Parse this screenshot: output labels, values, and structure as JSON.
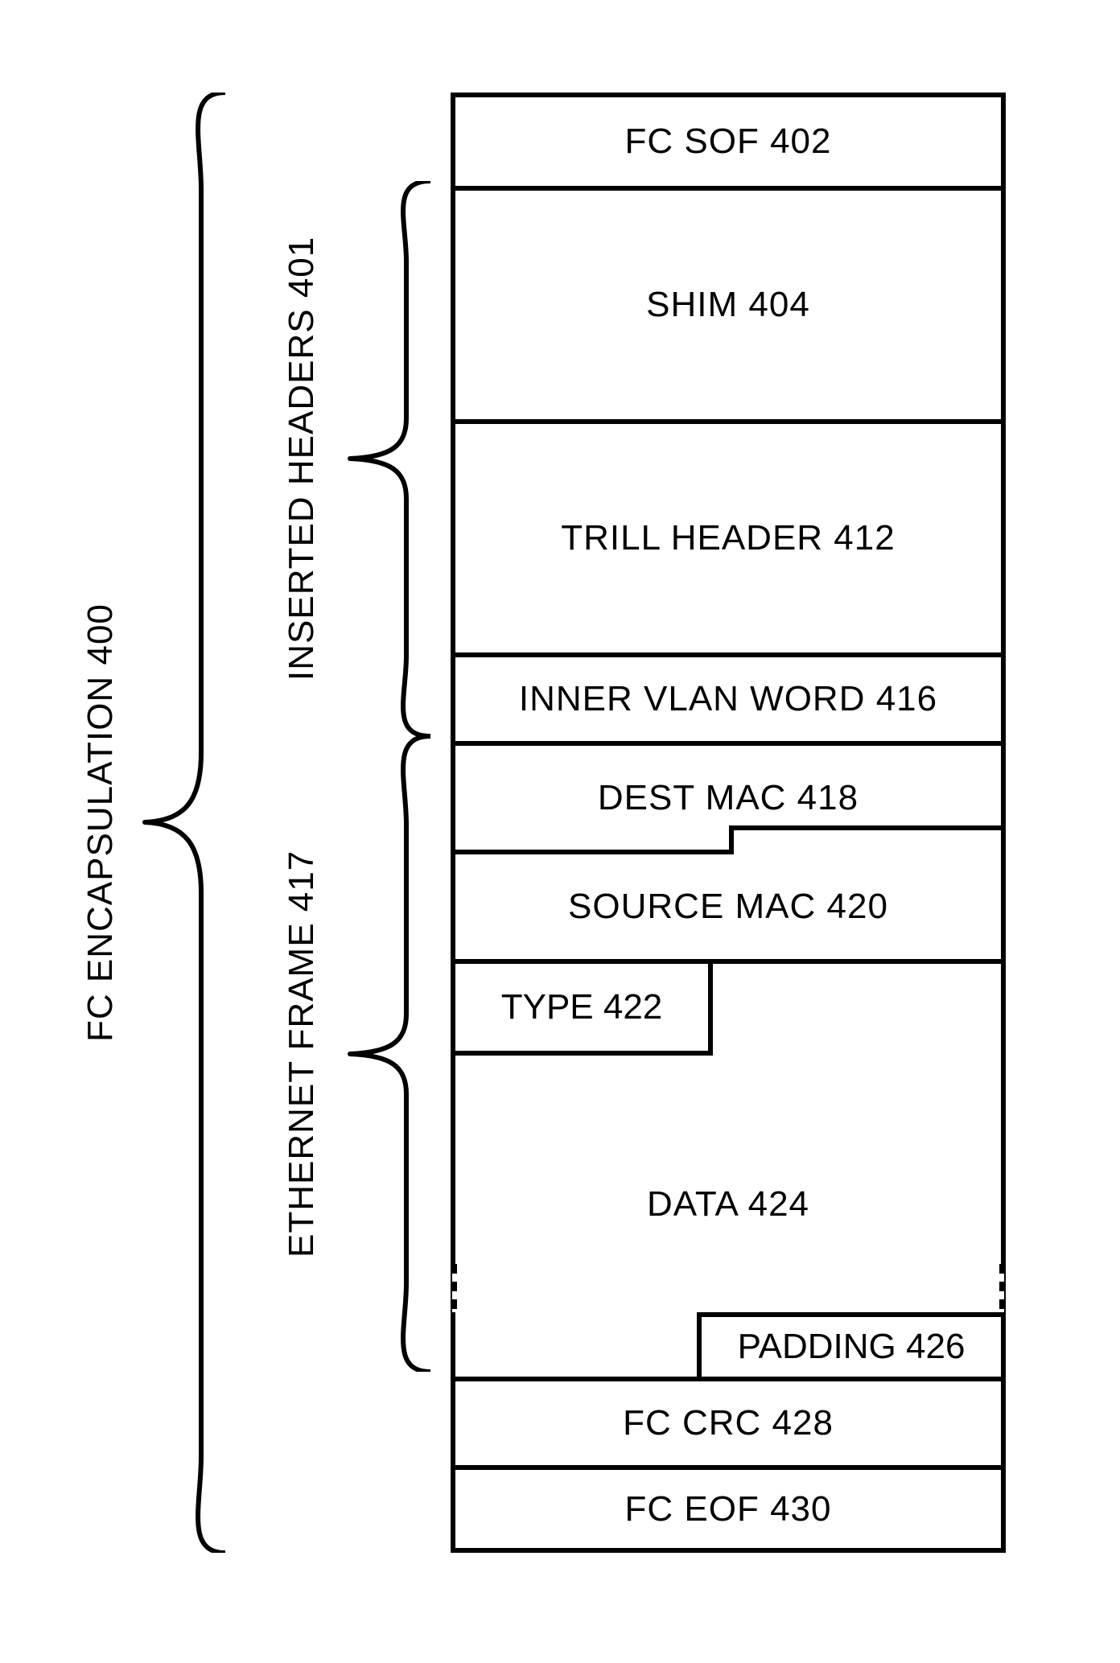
{
  "diagram": {
    "outer_label": "FC ENCAPSULATION 400",
    "inserted_headers_label": "INSERTED HEADERS 401",
    "ethernet_frame_label": "ETHERNET FRAME 417",
    "cells": {
      "fc_sof": "FC SOF 402",
      "shim": "SHIM 404",
      "trill_header": "TRILL HEADER 412",
      "inner_vlan": "INNER VLAN WORD 416",
      "dest_mac": "DEST MAC 418",
      "source_mac": "SOURCE MAC 420",
      "type": "TYPE 422",
      "data": "DATA 424",
      "padding": "PADDING 426",
      "fc_crc": "FC CRC 428",
      "fc_eof": "FC EOF 430"
    }
  }
}
